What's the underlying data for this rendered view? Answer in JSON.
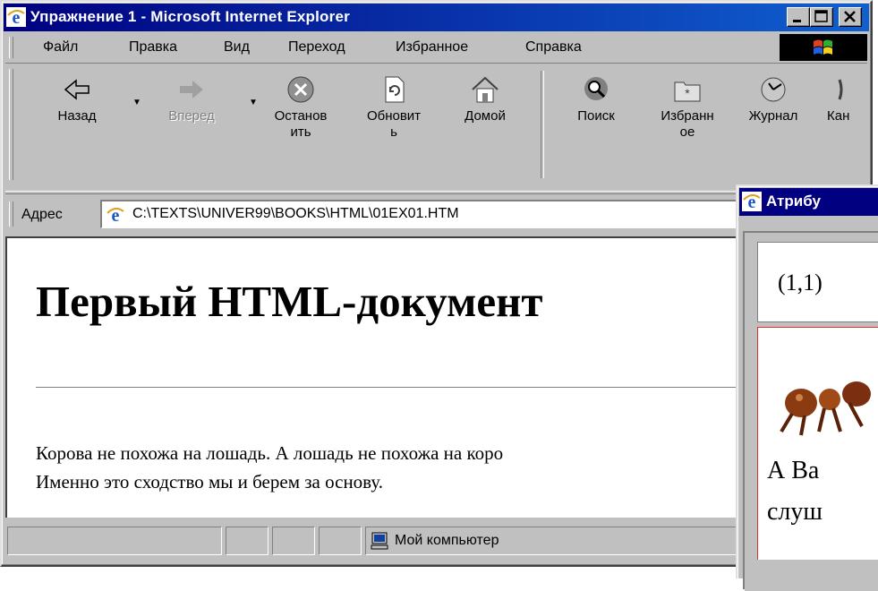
{
  "window": {
    "title": "Упражнение 1 - Microsoft Internet Explorer"
  },
  "menu": {
    "items": [
      {
        "label": "Файл"
      },
      {
        "label": "Правка"
      },
      {
        "label": "Вид"
      },
      {
        "label": "Переход"
      },
      {
        "label": "Избранное"
      },
      {
        "label": "Справка"
      }
    ]
  },
  "toolbar": {
    "back": {
      "line1": "Назад",
      "line2": ""
    },
    "forward": {
      "line1": "Вперед",
      "line2": ""
    },
    "stop": {
      "line1": "Останов",
      "line2": "ить"
    },
    "refresh": {
      "line1": "Обновит",
      "line2": "ь"
    },
    "home": {
      "line1": "Домой",
      "line2": ""
    },
    "search": {
      "line1": "Поиск",
      "line2": ""
    },
    "favorites": {
      "line1": "Избранн",
      "line2": "ое"
    },
    "history": {
      "line1": "Журнал",
      "line2": ""
    },
    "channels": {
      "line1": "Кан",
      "line2": ""
    }
  },
  "address": {
    "label": "Адрес",
    "value": "C:\\TEXTS\\UNIVER99\\BOOKS\\HTML\\01EX01.HTM"
  },
  "document": {
    "heading": "Первый HTML-документ",
    "paragraph_line1": "Корова не похожа на лошадь. А лошадь не похожа на коро",
    "paragraph_line2": "Именно это сходство мы и берем за основу."
  },
  "statusbar": {
    "zone_text": "Мой компьютер"
  },
  "window2": {
    "title": "Атрибу",
    "cell_text": "(1,1)",
    "line1": "А Ва",
    "line2": "слуш"
  },
  "colors": {
    "titlebar_active": "#000080",
    "face": "#c0c0c0",
    "cell_border": "#e03030"
  }
}
